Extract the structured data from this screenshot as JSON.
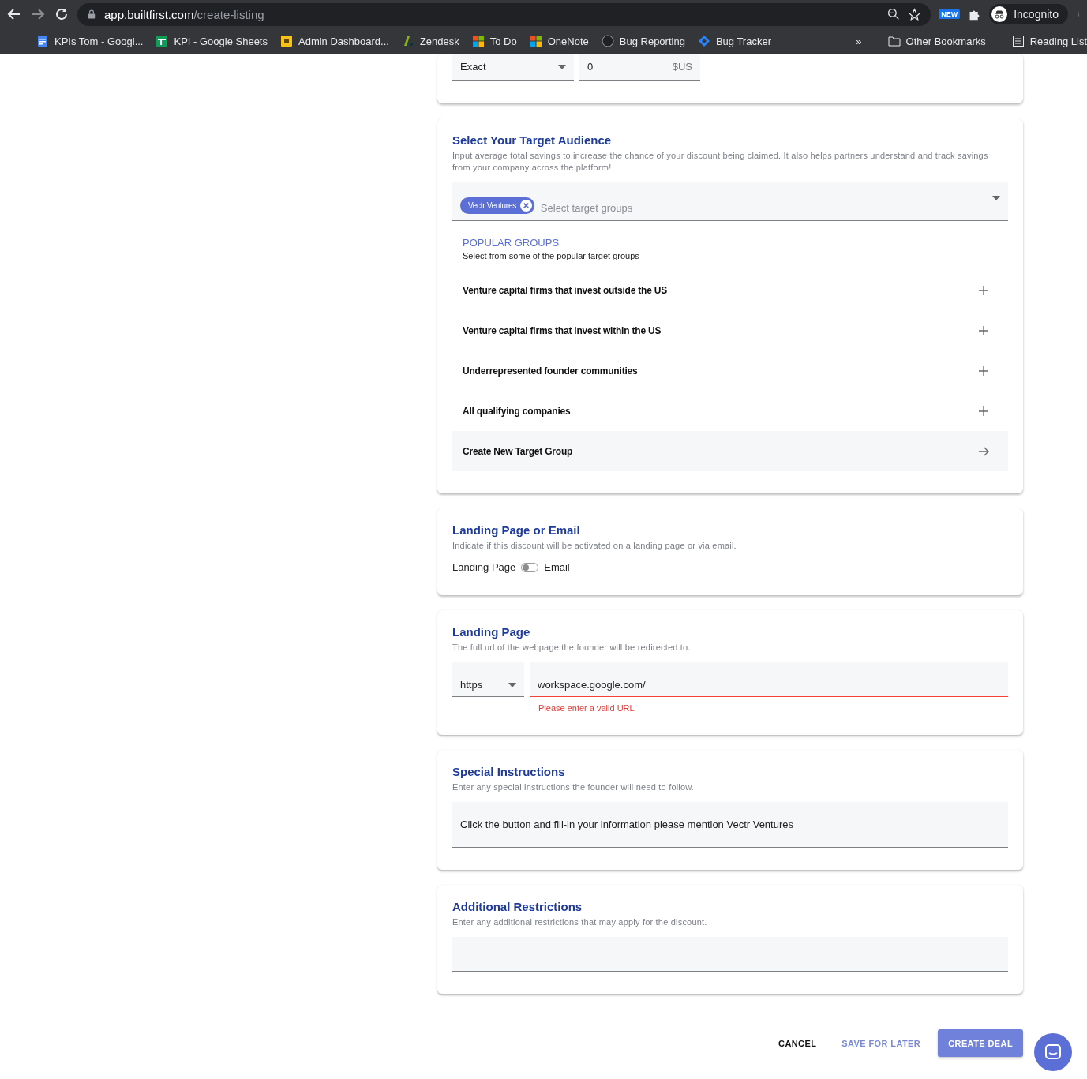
{
  "browser": {
    "url_host": "app.builtfirst.com",
    "url_path": "/create-listing",
    "badge": "NEW",
    "profile": "Incognito",
    "bookmarks": [
      {
        "kind": "doc",
        "label": "KPIs Tom - Googl..."
      },
      {
        "kind": "sheet",
        "label": "KPI - Google Sheets"
      },
      {
        "kind": "bf",
        "label": "Admin Dashboard..."
      },
      {
        "kind": "zendesk",
        "label": "Zendesk"
      },
      {
        "kind": "ms",
        "label": "To Do"
      },
      {
        "kind": "ms",
        "label": "OneNote"
      },
      {
        "kind": "circle",
        "label": "Bug Reporting"
      },
      {
        "kind": "diamond",
        "label": "Bug Tracker"
      }
    ],
    "more": "»",
    "other_bookmarks": "Other Bookmarks",
    "reading_list": "Reading List"
  },
  "amount_card": {
    "match": "Exact",
    "amount": "0",
    "currency": "$US"
  },
  "audience_card": {
    "title": "Select Your Target Audience",
    "description": "Input average total savings to increase the chance of your discount being claimed. It also helps partners understand and track savings from your company across the platform!",
    "chips": [
      "Vectr Ventures"
    ],
    "placeholder": "Select target groups",
    "popular_heading": "POPULAR GROUPS",
    "popular_subheading": "Select from some of the popular target groups",
    "groups": [
      {
        "kind": "add",
        "label": "Venture capital firms that invest outside the US"
      },
      {
        "kind": "add",
        "label": "Venture capital firms that invest within the US"
      },
      {
        "kind": "add",
        "label": "Underrepresented founder communities"
      },
      {
        "kind": "add",
        "label": "All qualifying companies"
      },
      {
        "kind": "create",
        "label": "Create New Target Group"
      }
    ]
  },
  "delivery_card": {
    "title": "Landing Page or Email",
    "description": "Indicate if this discount will be activated on a landing page or via email.",
    "left_label": "Landing Page",
    "right_label": "Email",
    "on": false
  },
  "landing_card": {
    "title": "Landing Page",
    "description": "The full url of the webpage the founder will be redirected to.",
    "protocol": "https",
    "url": "workspace.google.com/",
    "error": "Please enter a valid URL"
  },
  "instructions_card": {
    "title": "Special Instructions",
    "description": "Enter any special instructions the founder will need to follow.",
    "value": "Click the button and fill-in your information please mention Vectr Ventures"
  },
  "restrictions_card": {
    "title": "Additional Restrictions",
    "description": "Enter any additional restrictions that may apply for the discount."
  },
  "actions": {
    "cancel": "CANCEL",
    "save": "SAVE FOR LATER",
    "create": "CREATE DEAL"
  }
}
